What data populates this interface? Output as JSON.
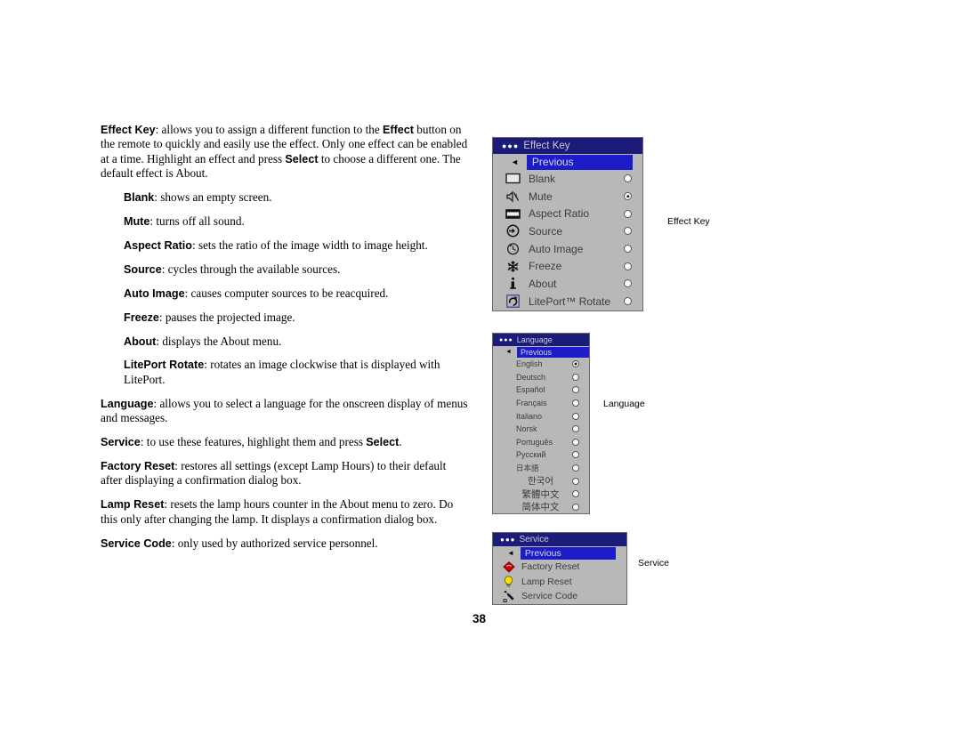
{
  "page": {
    "number": "38"
  },
  "body_paragraphs": [
    {
      "id": "effect-key-para",
      "indent": false,
      "html": "<b>Effect Key</b>: allows you to assign a different function to the <b>Effect</b> button on the remote to quickly and easily use the effect. Only one effect can be enabled at a time. Highlight an effect and press <b>Select</b> to choose a different one. The default effect is About."
    },
    {
      "id": "blank-para",
      "indent": true,
      "html": "<b>Blank</b>: shows an empty screen."
    },
    {
      "id": "mute-para",
      "indent": true,
      "html": "<b>Mute</b>: turns off all sound."
    },
    {
      "id": "aspect-ratio-para",
      "indent": true,
      "html": "<b>Aspect Ratio</b>: sets the ratio of the image width to image height."
    },
    {
      "id": "source-para",
      "indent": true,
      "html": "<b>Source</b>: cycles through the available sources."
    },
    {
      "id": "auto-image-para",
      "indent": true,
      "html": "<b>Auto Image</b>: causes computer sources to be reacquired."
    },
    {
      "id": "freeze-para",
      "indent": true,
      "html": "<b>Freeze</b>: pauses the projected image."
    },
    {
      "id": "about-para",
      "indent": true,
      "html": "<b>About</b>: displays the About menu."
    },
    {
      "id": "liteport-rotate-para",
      "indent": true,
      "html": "<b>LitePort Rotate</b>: rotates an image clockwise that is displayed with LitePort."
    },
    {
      "id": "language-para",
      "indent": false,
      "html": "<b>Language</b>: allows you to select a language for the onscreen display of menus and messages."
    },
    {
      "id": "service-para",
      "indent": false,
      "html": "<b>Service</b>: to use these features, highlight them and press <b>Select</b>."
    },
    {
      "id": "factory-reset-para",
      "indent": false,
      "html": "<b>Factory Reset</b>: restores all settings (except Lamp Hours) to their default after displaying a confirmation dialog box."
    },
    {
      "id": "lamp-reset-para",
      "indent": false,
      "html": "<b>Lamp Reset</b>: resets the lamp hours counter in the About menu to zero. Do this only after changing the lamp. It displays a confirmation dialog box."
    },
    {
      "id": "service-code-para",
      "indent": false,
      "html": "<b>Service Code</b>: only used by authorized service personnel."
    }
  ],
  "osd": {
    "colors": {
      "title_bar": "#1b1b7a",
      "highlight": "#1c1cc8",
      "menu_background": "#b8b8b8",
      "menu_border": "#6b6b6b",
      "label_text": "#3c3c3c",
      "factory_reset_icon": "#d00000",
      "lamp_reset_icon": "#f2e000"
    },
    "dots_glyph": "●●●",
    "previous_arrow_glyph": "◄",
    "effect_key": {
      "title": "Effect Key",
      "previous_label": "Previous",
      "items": [
        {
          "label": "Blank",
          "icon": "blank-screen-icon",
          "selected": false
        },
        {
          "label": "Mute",
          "icon": "mute-speaker-icon",
          "selected": true
        },
        {
          "label": "Aspect Ratio",
          "icon": "aspect-ratio-icon",
          "selected": false
        },
        {
          "label": "Source",
          "icon": "source-input-icon",
          "selected": false
        },
        {
          "label": "Auto Image",
          "icon": "auto-image-icon",
          "selected": false
        },
        {
          "label": "Freeze",
          "icon": "freeze-snowflake-icon",
          "selected": false
        },
        {
          "label": "About",
          "icon": "info-icon",
          "selected": false
        },
        {
          "label": "LitePort™ Rotate",
          "icon": "rotate-icon",
          "selected": false
        }
      ]
    },
    "language": {
      "title": "Language",
      "previous_label": "Previous",
      "items": [
        {
          "label": "English",
          "selected": true,
          "script": "latin"
        },
        {
          "label": "Deutsch",
          "selected": false,
          "script": "latin"
        },
        {
          "label": "Español",
          "selected": false,
          "script": "latin"
        },
        {
          "label": "Français",
          "selected": false,
          "script": "latin"
        },
        {
          "label": "Italiano",
          "selected": false,
          "script": "latin"
        },
        {
          "label": "Norsk",
          "selected": false,
          "script": "latin"
        },
        {
          "label": "Português",
          "selected": false,
          "script": "latin"
        },
        {
          "label": "Русский",
          "selected": false,
          "script": "latin"
        },
        {
          "label": "日本語",
          "selected": false,
          "script": "cjk"
        },
        {
          "label": "한국어",
          "selected": false,
          "script": "cjk-big"
        },
        {
          "label": "繁體中文",
          "selected": false,
          "script": "cjk-big"
        },
        {
          "label": "简体中文",
          "selected": false,
          "script": "cjk-big"
        }
      ]
    },
    "service": {
      "title": "Service",
      "previous_label": "Previous",
      "items": [
        {
          "label": "Factory Reset",
          "icon": "factory-reset-gem-icon"
        },
        {
          "label": "Lamp Reset",
          "icon": "lamp-bulb-icon"
        },
        {
          "label": "Service Code",
          "icon": "wrench-icon"
        }
      ]
    }
  },
  "callouts": {
    "effect_key": "Effect Key",
    "language": "Language",
    "service": "Service"
  }
}
